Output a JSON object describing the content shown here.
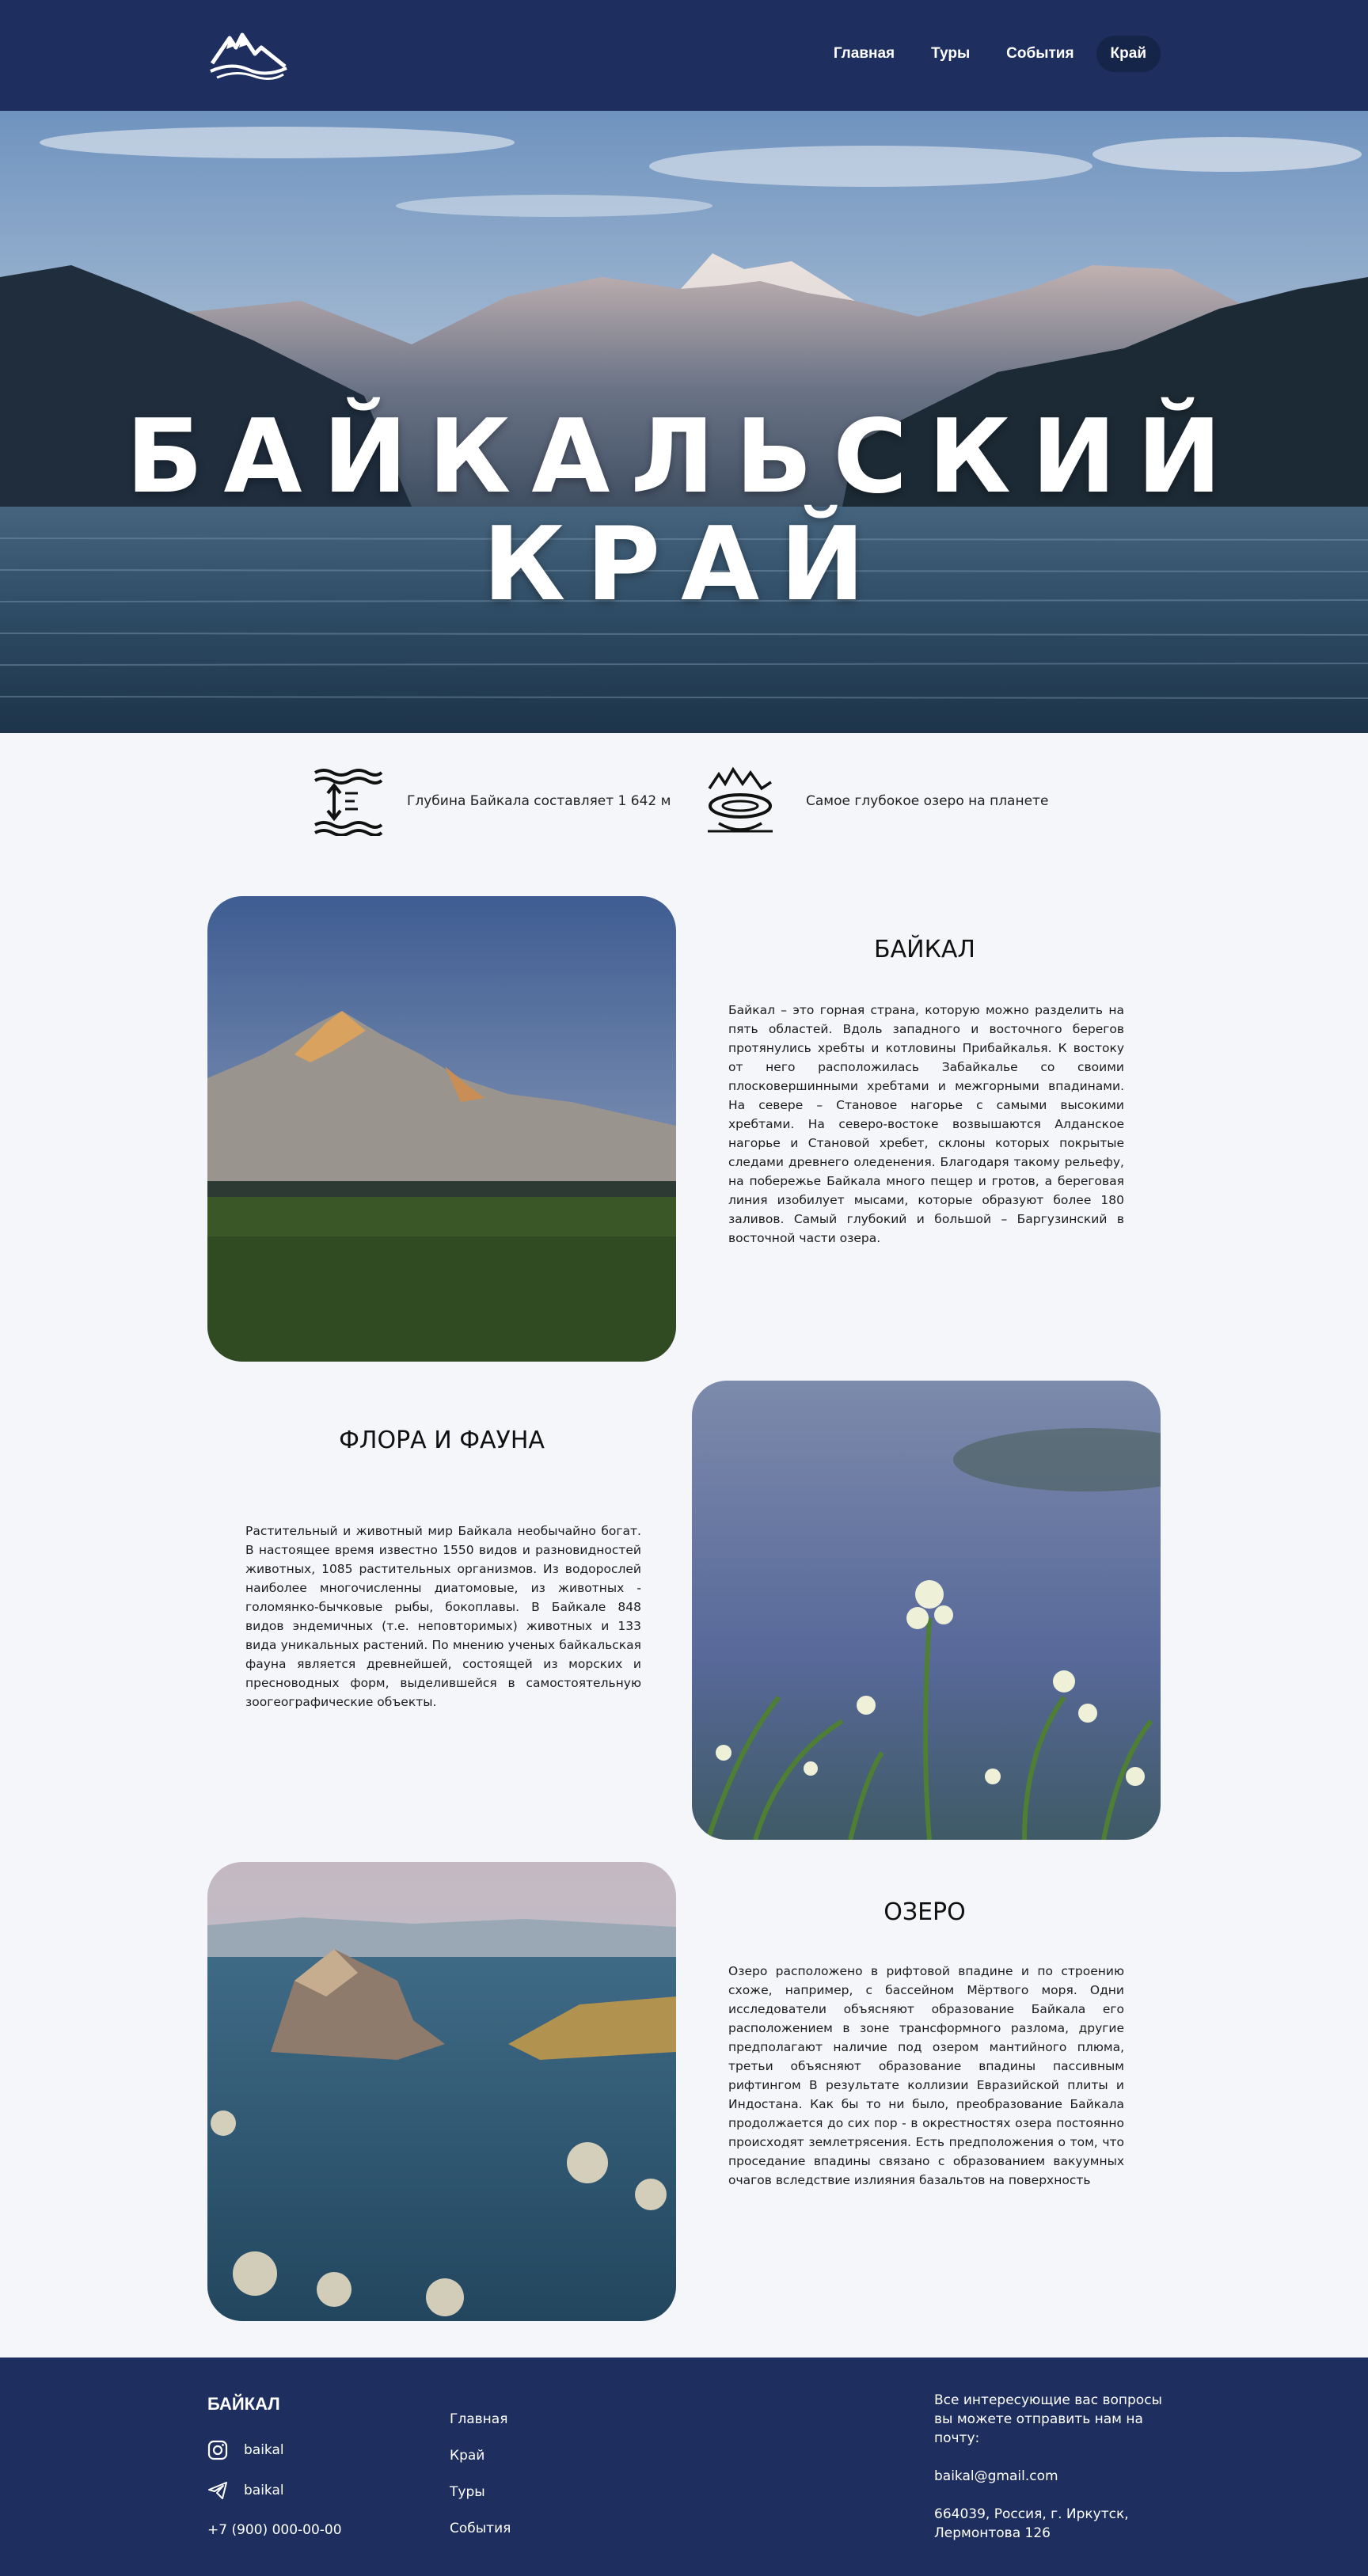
{
  "header": {
    "logo_icon": "mountains-logo-icon",
    "nav": [
      {
        "label": "Главная"
      },
      {
        "label": "Туры"
      },
      {
        "label": "События"
      },
      {
        "label": "Край"
      }
    ]
  },
  "hero": {
    "title_line1": "БАЙКАЛЬСКИЙ",
    "title_line2": "КРАЙ"
  },
  "facts": [
    {
      "icon": "depth-icon",
      "text": "Глубина Байкала составляет 1 642 м"
    },
    {
      "icon": "lake-mountains-icon",
      "text": "Самое глубокое озеро на планете"
    }
  ],
  "sections": {
    "baikal": {
      "title": "БАЙКАЛ",
      "text": "Байкал – это горная страна, которую можно разделить на пять областей. Вдоль западного и восточного берегов протянулись хребты и котловины Прибайкалья. К востоку от него расположилась Забайкалье со своими плосковершинными хребтами и межгорными впадинами. На севере – Становое нагорье с самыми высокими хребтами. На северо-востоке возвышаются Алданское нагорье и Становой хребет, склоны которых покрытые следами древнего оледенения. Благодаря такому рельефу, на побережье Байкала много пещер и гротов, а береговая линия изобилует мысами, которые образуют более 180 заливов. Самый глубокий и большой – Баргузинский в восточной части озера."
    },
    "flora": {
      "title": "ФЛОРА И ФАУНА",
      "text": "Растительный и животный мир Байкала необычайно богат. В настоящее время известно 1550 видов и разновидностей животных, 1085 растительных организмов. Из водорослей наиболее многочисленны диатомовые, из животных - голомянко-бычковые рыбы, бокоплавы. В Байкале 848 видов эндемичных (т.е. неповторимых) животных и 133 вида уникальных растений. По мнению ученых байкальская фауна является древнейшей, состоящей из морских и пресноводных форм, выделившейся в самостоятельную зоогеографические объекты."
    },
    "lake": {
      "title": "ОЗЕРО",
      "text": "Озеро расположено в рифтовой впадине и по строению схоже, например, с бассейном Мёртвого моря. Одни исследователи объясняют образование Байкала его расположением в зоне трансформного разлома, другие предполагают наличие под озером мантийного плюма, третьи объясняют образование впадины пассивным рифтингом В результате коллизии Евразийской плиты и Индостана. Как бы то ни было, преобразование Байкала продолжается до сих пор - в окрестностях озера постоянно происходят землетрясения. Есть предположения о том, что проседание впадины связано с образованием вакуумных очагов вследствие излияния базальтов на поверхность"
    }
  },
  "footer": {
    "brand": "БАЙКАЛ",
    "instagram": "baikal",
    "telegram": "baikal",
    "phone": "+7 (900) 000-00-00",
    "nav": [
      {
        "label": "Главная"
      },
      {
        "label": "Край"
      },
      {
        "label": "Туры"
      },
      {
        "label": "События"
      }
    ],
    "contact_note": "Все интересующие вас вопросы вы можете отправить нам на почту:",
    "email": "baikal@gmail.com",
    "address": "664039, Россия, г. Иркутск, Лермонтова 126"
  }
}
